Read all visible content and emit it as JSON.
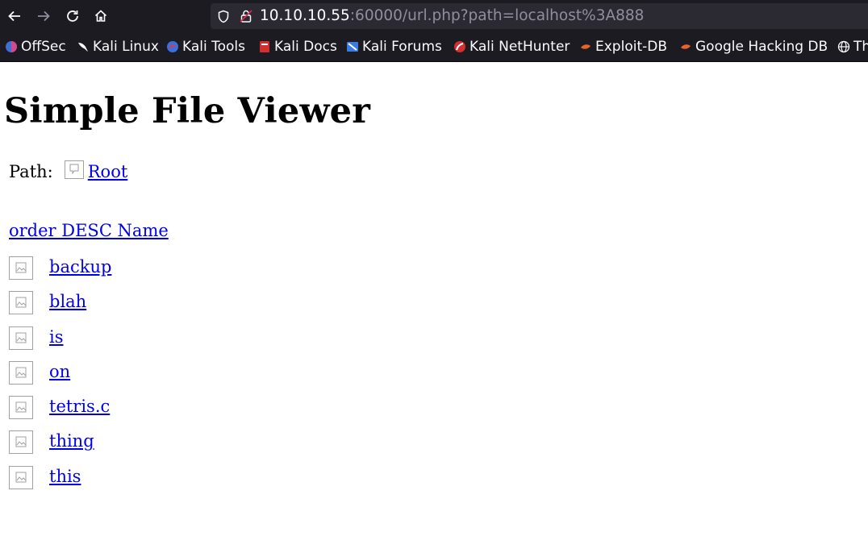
{
  "browser": {
    "url": {
      "host": "10.10.10.55",
      "rest": ":60000/url.php?path=localhost%3A888"
    },
    "bookmarks": [
      {
        "label": "OffSec",
        "icon": "offsec-icon"
      },
      {
        "label": "Kali Linux",
        "icon": "kali-dragon-icon"
      },
      {
        "label": "Kali Tools",
        "icon": "kali-tools-icon"
      },
      {
        "label": "Kali Docs",
        "icon": "kali-docs-icon"
      },
      {
        "label": "Kali Forums",
        "icon": "kali-forums-icon"
      },
      {
        "label": "Kali NetHunter",
        "icon": "kali-nethunter-icon"
      },
      {
        "label": "Exploit-DB",
        "icon": "exploit-db-icon"
      },
      {
        "label": "Google Hacking DB",
        "icon": "ghdb-icon"
      },
      {
        "label": "Th",
        "icon": "globe-icon"
      }
    ]
  },
  "page": {
    "title": "Simple File Viewer",
    "path_label": "Path:",
    "root_link": "Root",
    "order_link": "order DESC Name",
    "files": [
      "backup",
      "blah",
      "is",
      "on",
      "tetris.c",
      "thing",
      "this"
    ]
  },
  "colors": {
    "chrome_bg": "#1c1b22",
    "urlbar_bg": "#2b2a33",
    "link": "#0000ee"
  }
}
